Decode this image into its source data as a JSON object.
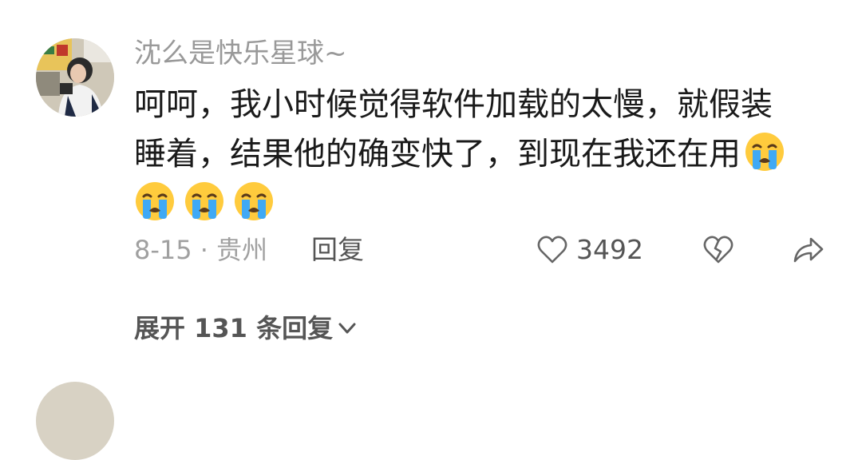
{
  "comment": {
    "username": "沈么是快乐星球~",
    "text_line1": "呵呵，我小时候觉得软件加载的太慢，就假装",
    "text_line2": "睡着，结果他的确变快了，到现在我还在用",
    "emojis": [
      "crying-face-emoji",
      "crying-face-emoji",
      "crying-face-emoji",
      "crying-face-emoji"
    ],
    "meta": "8-15 · 贵州",
    "reply_label": "回复",
    "like_count": "3492"
  },
  "expand": {
    "label": "展开 131 条回复"
  },
  "icons": {
    "like": "heart-icon",
    "dislike": "broken-heart-icon",
    "share": "share-icon",
    "expand": "chevron-down-icon"
  },
  "colors": {
    "text_primary": "#1a1a1a",
    "text_secondary": "#999999",
    "action_gray": "#555555",
    "emoji_yellow": "#ffcb3d",
    "emoji_tears": "#3fa9f5"
  }
}
